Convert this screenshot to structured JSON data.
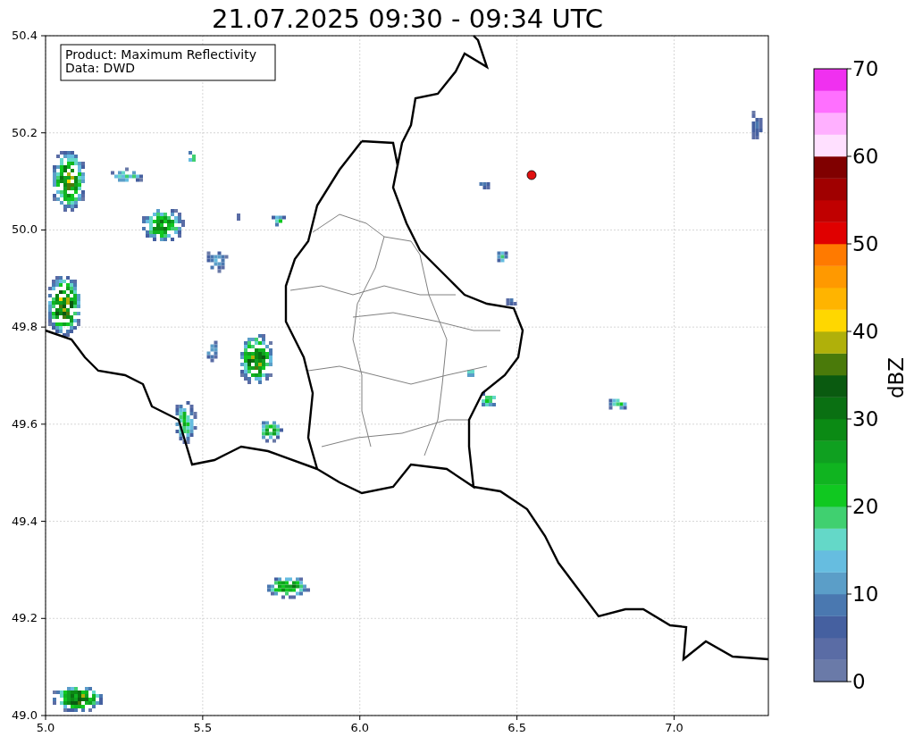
{
  "title": "21.07.2025 09:30 - 09:34 UTC",
  "info_box": [
    "Product: Maximum Reflectivity",
    "Data: DWD"
  ],
  "map": {
    "xticks": [
      "5.0",
      "5.5",
      "6.0",
      "6.5",
      "7.0"
    ],
    "yticks": [
      "50.4",
      "50.2",
      "50.0",
      "49.8",
      "49.6",
      "49.4",
      "49.2",
      "49.0"
    ]
  },
  "colorbar": {
    "label": "dBZ",
    "ticks": [
      "70",
      "60",
      "50",
      "40",
      "30",
      "20",
      "10",
      "0"
    ],
    "bins": [
      {
        "color": "#6a7aa8"
      },
      {
        "color": "#5a6ca5"
      },
      {
        "color": "#4560a0"
      },
      {
        "color": "#4a78b0"
      },
      {
        "color": "#5b9ec8"
      },
      {
        "color": "#66bde0"
      },
      {
        "color": "#64d8c8"
      },
      {
        "color": "#40d070"
      },
      {
        "color": "#10c820"
      },
      {
        "color": "#10b420"
      },
      {
        "color": "#0fa020"
      },
      {
        "color": "#0b8a14"
      },
      {
        "color": "#0a7012"
      },
      {
        "color": "#0a5a10"
      },
      {
        "color": "#4a7a0a"
      },
      {
        "color": "#b0b00a"
      },
      {
        "color": "#ffd700"
      },
      {
        "color": "#ffb400"
      },
      {
        "color": "#ff9900"
      },
      {
        "color": "#ff7a00"
      },
      {
        "color": "#e00000"
      },
      {
        "color": "#c00000"
      },
      {
        "color": "#a00000"
      },
      {
        "color": "#800000"
      },
      {
        "color": "#ffe0ff"
      },
      {
        "color": "#ffb0ff"
      },
      {
        "color": "#ff70ff"
      },
      {
        "color": "#f030f0"
      }
    ]
  }
}
